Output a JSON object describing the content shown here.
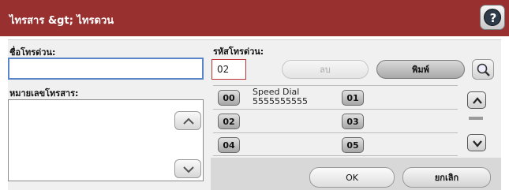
{
  "title": "ไทรสาร &gt; ไทรดวน",
  "help_glyph": "?",
  "fields": {
    "name_label": "ชื่อโทรด่วน:",
    "code_label": "รหัสโทรด่วน:",
    "code_value": "02",
    "number_label": "หมายเลขโทรสาร:"
  },
  "buttons": {
    "delete_label": "ลบ",
    "print_label": "พิมพ์",
    "ok_label": "OK",
    "cancel_label": "ยกเลิก"
  },
  "speed_dials": [
    {
      "code": "00",
      "name": "Speed Dial",
      "number": "5555555555"
    },
    {
      "code": "01",
      "name": "",
      "number": ""
    },
    {
      "code": "02",
      "name": "",
      "number": ""
    },
    {
      "code": "03",
      "name": "",
      "number": ""
    },
    {
      "code": "04",
      "name": "",
      "number": ""
    },
    {
      "code": "05",
      "name": "",
      "number": ""
    }
  ],
  "icons": {
    "help": "question-mark-icon",
    "search": "magnifier-icon",
    "scroll_up": "chevron-up-icon",
    "scroll_down": "chevron-down-icon"
  },
  "colors": {
    "title_bar": "#97302f",
    "field_focus": "#5a86c8",
    "code_border": "#bb3333"
  }
}
